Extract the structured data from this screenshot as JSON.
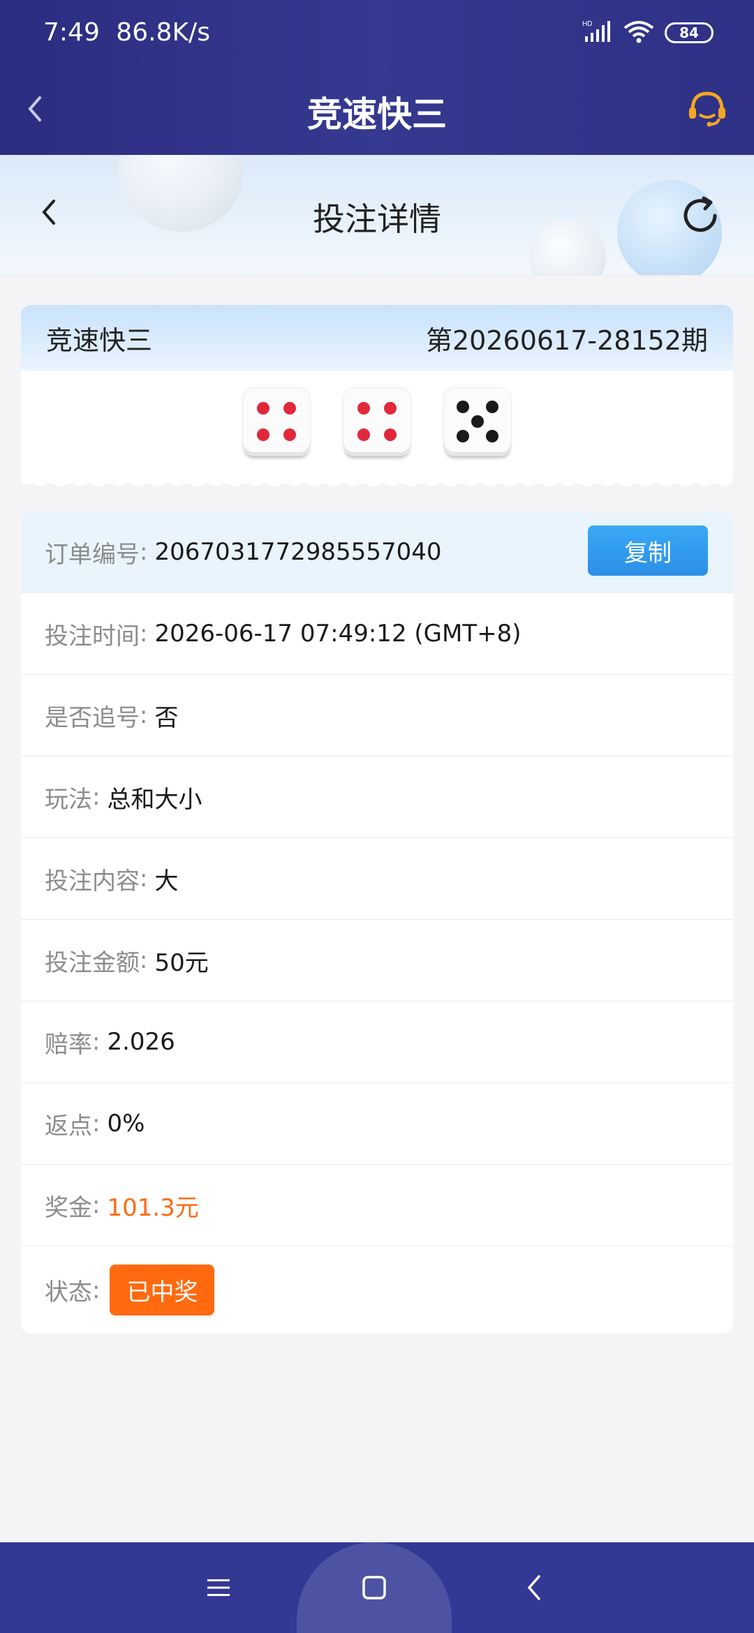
{
  "status_bar": {
    "time": "7:49",
    "speed": "86.8K/s",
    "signal_label": "HD",
    "battery": "84"
  },
  "app_header": {
    "title": "竞速快三"
  },
  "sub_header": {
    "title": "投注详情"
  },
  "draw": {
    "game": "竞速快三",
    "issue": "第20260617-28152期",
    "dice": [
      4,
      4,
      5
    ]
  },
  "details": {
    "order_label": "订单编号",
    "order_value": "2067031772985557040",
    "copy_label": "复制",
    "time_label": "投注时间",
    "time_value": "2026-06-17 07:49:12 (GMT+8)",
    "chase_label": "是否追号",
    "chase_value": "否",
    "play_label": "玩法",
    "play_value": "总和大小",
    "content_label": "投注内容",
    "content_value": "大",
    "amount_label": "投注金额",
    "amount_value": "50元",
    "odds_label": "赔率",
    "odds_value": "2.026",
    "rebate_label": "返点",
    "rebate_value": "0%",
    "prize_label": "奖金",
    "prize_value": "101.3元",
    "status_label": "状态",
    "status_value": "已中奖",
    "colon": ":"
  },
  "colors": {
    "header_bg": "#2e3185",
    "accent_blue": "#2c8fe8",
    "prize_orange": "#ff6a0f",
    "red_pip": "#e0283a"
  },
  "icons": {
    "app_back": "chevron-left-icon",
    "support": "customer-service-icon",
    "sub_back": "chevron-left-icon",
    "refresh": "refresh-icon",
    "nav_menu": "menu-icon",
    "nav_home": "square-home-icon",
    "nav_back": "triangle-back-icon"
  }
}
